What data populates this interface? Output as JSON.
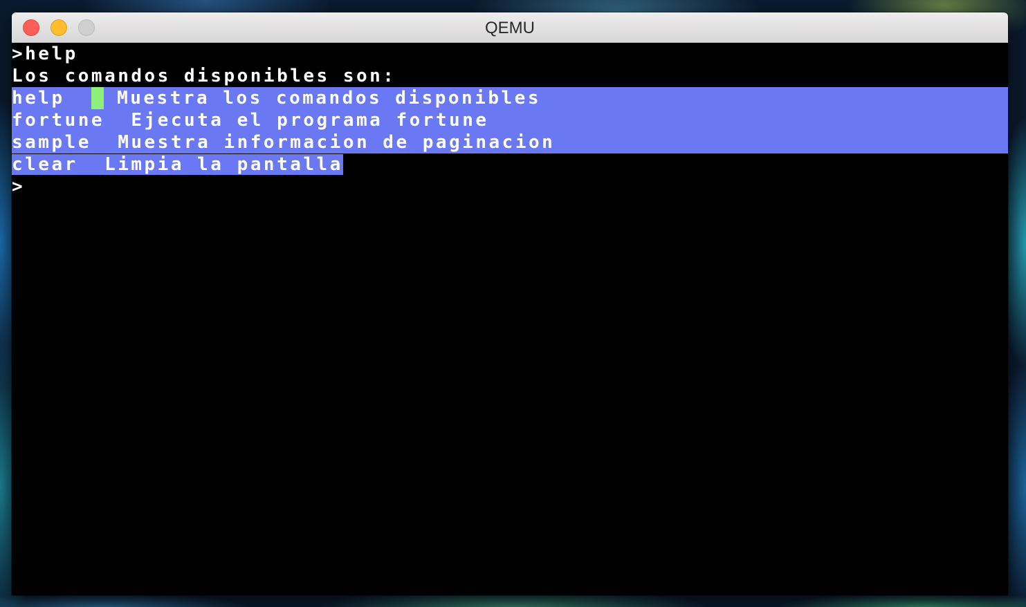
{
  "window": {
    "title": "QEMU"
  },
  "terminal": {
    "lines": [
      {
        "text": ">help"
      },
      {
        "text": "Los comandos disponibles son:"
      },
      {
        "cmd": "help  ",
        "desc": " Muestra los comandos disponibles"
      },
      {
        "text": "fortune  Ejecuta el programa fortune"
      },
      {
        "text": "sample  Muestra informacion de paginacion"
      },
      {
        "text": "clear  Limpia la pantalla"
      },
      {
        "text": ">"
      }
    ],
    "selection_color": "#6b78f4",
    "cursor_color": "#8ef079",
    "background_color": "#000000",
    "text_color": "#ffffff"
  }
}
